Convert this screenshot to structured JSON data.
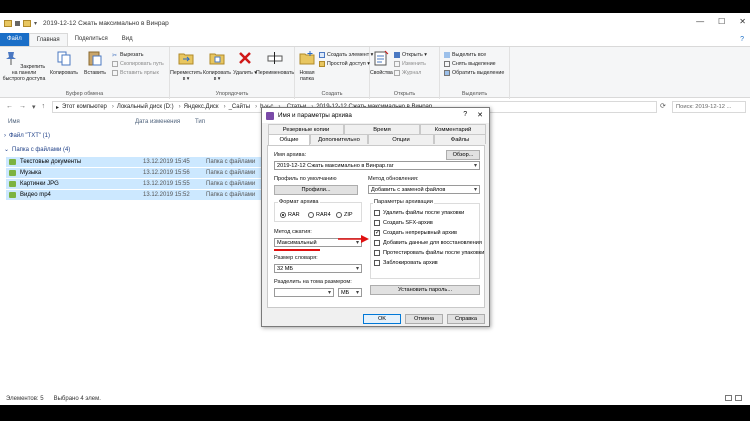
{
  "window": {
    "title": "2019-12-12 Сжать максимально в Винрар",
    "min": "—",
    "max": "☐",
    "close": "✕"
  },
  "ribbon_tabs": [
    "Файл",
    "Главная",
    "Поделиться",
    "Вид"
  ],
  "ribbon": {
    "clipboard": {
      "pin": "Закрепить на панели быстрого доступа",
      "copy": "Копировать",
      "paste": "Вставить",
      "cut": "Вырезать",
      "copy_path": "Скопировать путь",
      "paste_shortcut": "Вставить ярлык",
      "group": "Буфер обмена"
    },
    "organize": {
      "move": "Переместить в ▾",
      "copy_to": "Копировать в ▾",
      "delete": "Удалить ▾",
      "rename": "Переименовать",
      "group": "Упорядочить"
    },
    "new": {
      "new_folder": "Новая папка",
      "new_item": "Создать элемент ▾",
      "easy_access": "Простой доступ ▾",
      "group": "Создать"
    },
    "open": {
      "properties": "Свойства",
      "open": "Открыть ▾",
      "edit": "Изменить",
      "history": "Журнал",
      "group": "Открыть"
    },
    "select": {
      "select_all": "Выделить все",
      "select_none": "Снять выделение",
      "invert": "Обратить выделение",
      "group": "Выделить"
    }
  },
  "address": {
    "crumbs": [
      "Этот компьютер",
      "Локальный диск (D:)",
      "Яндекс.Диск",
      "_Сайты",
      "h-y-c",
      "_Статьи",
      "2019-12-12 Сжать максимально в Винрар"
    ],
    "search_placeholder": "Поиск: 2019-12-12 ..."
  },
  "columns": {
    "name": "Имя",
    "date": "Дата изменения",
    "type": "Тип"
  },
  "groups": [
    {
      "label": "Файл \"TXT\" (1)"
    },
    {
      "label": "Папка с файлами (4)"
    }
  ],
  "rows": [
    {
      "name": "Текстовые документы",
      "date": "13.12.2019 15:45",
      "type": "Папка с файлами"
    },
    {
      "name": "Музыка",
      "date": "13.12.2019 15:56",
      "type": "Папка с файлами"
    },
    {
      "name": "Картинки JPG",
      "date": "13.12.2019 15:55",
      "type": "Папка с файлами"
    },
    {
      "name": "Видео mp4",
      "date": "13.12.2019 15:52",
      "type": "Папка с файлами"
    }
  ],
  "status": {
    "count": "Элементов: 5",
    "selected": "Выбрано 4 элем."
  },
  "dialog": {
    "title": "Имя и параметры архива",
    "help": "?",
    "close": "✕",
    "tabs_top": [
      "Резервные копии",
      "Время",
      "Комментарий"
    ],
    "tabs_bottom": [
      "Общие",
      "Дополнительно",
      "Опции",
      "Файлы"
    ],
    "archive_name_label": "Имя архива:",
    "archive_name": "2019-12-12 Сжать максимально в Винрар.rar",
    "browse": "Обзор...",
    "profile_label": "Профиль по умолчанию",
    "profiles_btn": "Профили...",
    "update_label": "Метод обновления:",
    "update_value": "Добавить с заменой файлов",
    "format_label": "Формат архива",
    "formats": [
      "RAR",
      "RAR4",
      "ZIP"
    ],
    "method_label": "Метод сжатия:",
    "method_value": "Максимальный",
    "dict_label": "Размер словаря:",
    "dict_value": "32 МБ",
    "split_label": "Разделить на тома размером:",
    "split_unit": "МБ",
    "options_label": "Параметры архивации",
    "options": [
      {
        "label": "Удалить файлы после упаковки",
        "checked": false
      },
      {
        "label": "Создать SFX-архив",
        "checked": false
      },
      {
        "label": "Создать непрерывный архив",
        "checked": true
      },
      {
        "label": "Добавить данные для восстановления",
        "checked": false
      },
      {
        "label": "Протестировать файлы после упаковки",
        "checked": false
      },
      {
        "label": "Заблокировать архив",
        "checked": false
      }
    ],
    "password_btn": "Установить пароль...",
    "ok": "OK",
    "cancel": "Отмена",
    "help_btn": "Справка"
  },
  "colors": {
    "accent": "#1a6ec7",
    "selection": "#cce8ff",
    "highlight": "#e01010"
  }
}
